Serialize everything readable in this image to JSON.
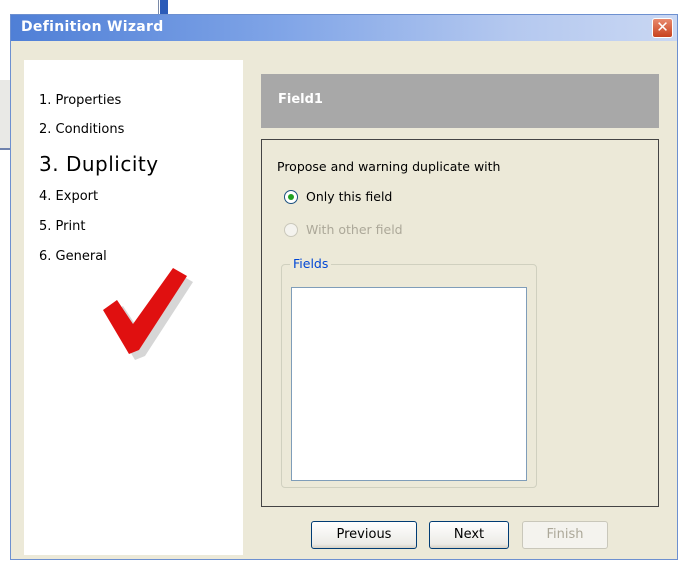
{
  "window": {
    "title": "Definition Wizard",
    "close_label": "✕"
  },
  "steps": [
    {
      "label": "1. Properties"
    },
    {
      "label": "2. Conditions"
    },
    {
      "label": "3. Duplicity"
    },
    {
      "label": "4. Export"
    },
    {
      "label": "5. Print"
    },
    {
      "label": "6. General"
    }
  ],
  "current_step_index": 2,
  "header": {
    "title": "Field1"
  },
  "content": {
    "prompt": "Propose and warning duplicate with",
    "options": [
      {
        "label": "Only this field",
        "selected": true,
        "enabled": true
      },
      {
        "label": "With other field",
        "selected": false,
        "enabled": false
      }
    ],
    "fields_group": {
      "legend": "Fields",
      "items": []
    }
  },
  "buttons": {
    "previous": "Previous",
    "next": "Next",
    "finish": "Finish",
    "finish_enabled": false
  },
  "colors": {
    "titlebar_start": "#4f7fd6",
    "window_bg": "#ece9d8",
    "header_bg": "#a8a8a8",
    "checkmark": "#e01010",
    "legend_text": "#0046d5"
  }
}
